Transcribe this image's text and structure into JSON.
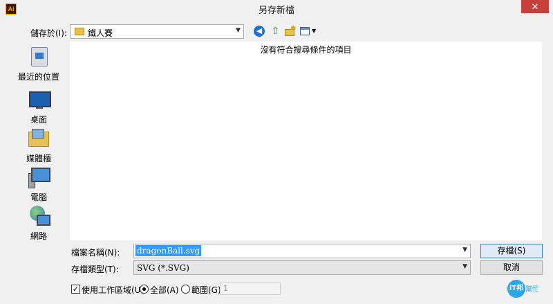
{
  "window": {
    "title": "另存新檔",
    "app_icon_text": "Ai",
    "close_glyph": "✕"
  },
  "location": {
    "label": "儲存於(I):",
    "value": "鐵人賽"
  },
  "toolbar": {
    "icons": [
      "back-icon",
      "up-folder-icon",
      "new-folder-icon",
      "view-menu-icon"
    ]
  },
  "places": [
    {
      "label": "最近的位置",
      "icon": "recent-places-icon"
    },
    {
      "label": "桌面",
      "icon": "desktop-icon"
    },
    {
      "label": "媒體櫃",
      "icon": "libraries-icon"
    },
    {
      "label": "電腦",
      "icon": "computer-icon"
    },
    {
      "label": "網路",
      "icon": "network-icon"
    }
  ],
  "file_list": {
    "empty_message": "沒有符合搜尋條件的項目"
  },
  "filename": {
    "label": "檔案名稱(N):",
    "value": "dragonBall.svg"
  },
  "filetype": {
    "label": "存檔類型(T):",
    "value": "SVG (*.SVG)"
  },
  "buttons": {
    "save": "存檔(S)",
    "cancel": "取消"
  },
  "options": {
    "use_artboards": {
      "label": "使用工作區域(U)",
      "checked": true
    },
    "all": {
      "label": "全部(A)",
      "selected": true
    },
    "range": {
      "label": "範圍(G):",
      "value": "1"
    }
  },
  "watermark": {
    "circle_text": "iT邦",
    "text": "幫忙"
  }
}
